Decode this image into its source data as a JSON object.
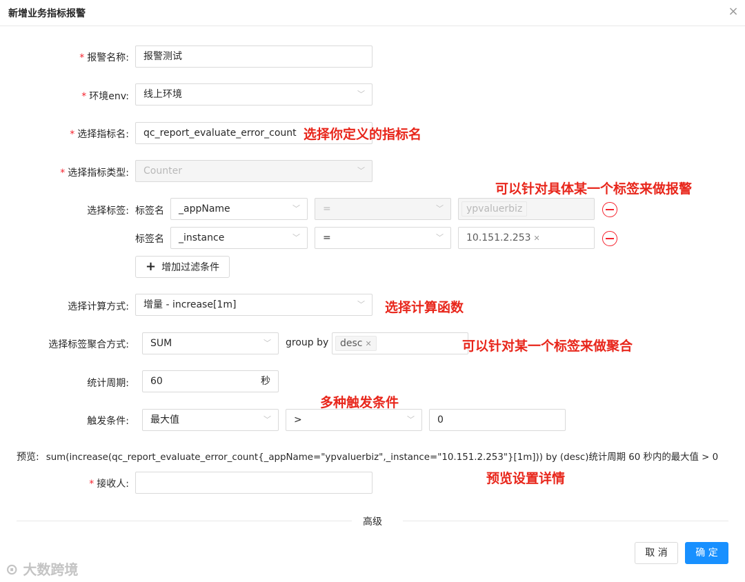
{
  "dialog": {
    "title": "新增业务指标报警",
    "close_icon": "×"
  },
  "form": {
    "required_mark": "*",
    "alert_name": {
      "label": "报警名称:",
      "value": "报警测试"
    },
    "env": {
      "label": "环境env:",
      "value": "线上环境"
    },
    "metric_name": {
      "label": "选择指标名:",
      "value": "qc_report_evaluate_error_count"
    },
    "metric_type": {
      "label": "选择指标类型:",
      "value": "Counter"
    },
    "tags": {
      "label": "选择标签:",
      "rows": [
        {
          "row_label": "标签名",
          "key": "_appName",
          "op": "=",
          "value_tag": "ypvaluerbiz"
        },
        {
          "row_label": "标签名",
          "key": "_instance",
          "op": "=",
          "value_tag": "10.151.2.253"
        }
      ],
      "add_button": "增加过滤条件"
    },
    "calc": {
      "label": "选择计算方式:",
      "value": "增量 - increase[1m]"
    },
    "aggregate": {
      "label": "选择标签聚合方式:",
      "value": "SUM",
      "group_by_label": "group by",
      "group_by_tag": "desc"
    },
    "period": {
      "label": "统计周期:",
      "value": "60",
      "unit": "秒"
    },
    "trigger": {
      "label": "触发条件:",
      "func": "最大值",
      "op": ">",
      "threshold": "0"
    },
    "preview": {
      "label": "预览:",
      "text": "sum(increase(qc_report_evaluate_error_count{_appName=\"ypvaluerbiz\",_instance=\"10.151.2.253\"}[1m])) by (desc)统计周期 60 秒内的最大值 > 0"
    },
    "receiver": {
      "label": "接收人:",
      "value": ""
    },
    "advanced": "高级"
  },
  "annotations": {
    "metric_name": "选择你定义的指标名",
    "tag": "可以针对具体某一个标签来做报警",
    "calc": "选择计算函数",
    "aggregate": "可以针对某一个标签来做聚合",
    "trigger": "多种触发条件",
    "preview": "预览设置详情"
  },
  "footer": {
    "cancel": "取 消",
    "confirm": "确 定"
  },
  "watermark": "大数跨境",
  "colors": {
    "primary": "#1890ff",
    "required": "#f5222d",
    "annotation": "#e8261b"
  }
}
